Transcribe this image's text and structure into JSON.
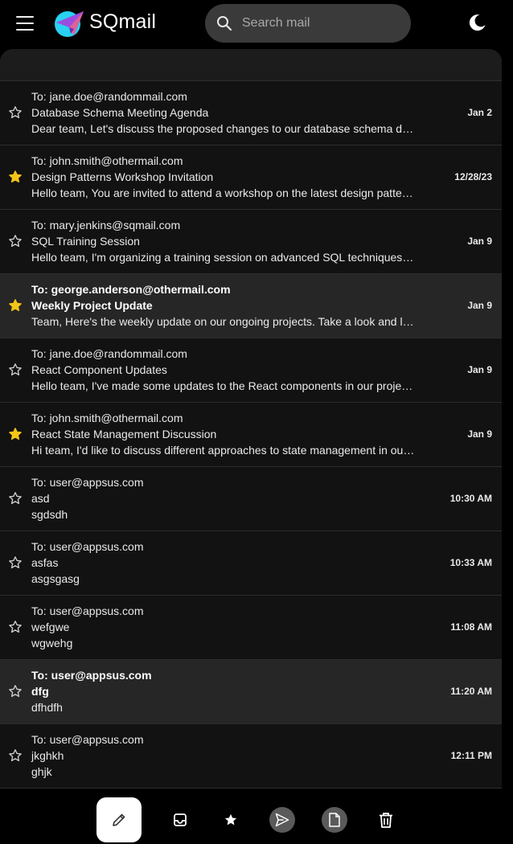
{
  "app": {
    "brand": "SQmail",
    "search_placeholder": "Search mail",
    "accent_star": "#f5c518",
    "logo_colors": [
      "#2ad1f0",
      "#9b4de0",
      "#e0609a"
    ]
  },
  "mails": [
    {
      "to": "To: jane.doe@randommail.com",
      "subject": "Database Schema Meeting Agenda",
      "preview": "Dear team, Let's discuss the proposed changes to our database schema during our next meeting.",
      "date": "Jan 2",
      "starred": false,
      "unread": false
    },
    {
      "to": "To: john.smith@othermail.com",
      "subject": "Design Patterns Workshop Invitation",
      "preview": "Hello team, You are invited to attend a workshop on the latest design patterns.",
      "date": "12/28/23",
      "starred": true,
      "unread": false
    },
    {
      "to": "To: mary.jenkins@sqmail.com",
      "subject": "SQL Training Session",
      "preview": "Hello team, I'm organizing a training session on advanced SQL techniques. Please join.",
      "date": "Jan 9",
      "starred": false,
      "unread": false
    },
    {
      "to": "To: george.anderson@othermail.com",
      "subject": "Weekly Project Update",
      "preview": "Team, Here's the weekly update on our ongoing projects. Take a look and let me know.",
      "date": "Jan 9",
      "starred": true,
      "unread": true
    },
    {
      "to": "To: jane.doe@randommail.com",
      "subject": "React Component Updates",
      "preview": "Hello team, I've made some updates to the React components in our project repository.",
      "date": "Jan 9",
      "starred": false,
      "unread": false
    },
    {
      "to": "To: john.smith@othermail.com",
      "subject": "React State Management Discussion",
      "preview": "Hi team, I'd like to discuss different approaches to state management in our app.",
      "date": "Jan 9",
      "starred": true,
      "unread": false
    },
    {
      "to": "To: user@appsus.com",
      "subject": "asd",
      "preview": "sgdsdh",
      "date": "10:30 AM",
      "starred": false,
      "unread": false
    },
    {
      "to": "To: user@appsus.com",
      "subject": "asfas",
      "preview": "asgsgasg",
      "date": "10:33 AM",
      "starred": false,
      "unread": false
    },
    {
      "to": "To: user@appsus.com",
      "subject": "wefgwe",
      "preview": "wgwehg",
      "date": "11:08 AM",
      "starred": false,
      "unread": false
    },
    {
      "to": "To: user@appsus.com",
      "subject": "dfg",
      "preview": "dfhdfh",
      "date": "11:20 AM",
      "starred": false,
      "unread": true
    },
    {
      "to": "To: user@appsus.com",
      "subject": "jkghkh",
      "preview": "ghjk",
      "date": "12:11 PM",
      "starred": false,
      "unread": false
    }
  ],
  "bottom_nav": {
    "items": [
      "compose-icon",
      "inbox-icon",
      "starred-icon",
      "sent-icon",
      "drafts-icon",
      "trash-icon"
    ],
    "active": "sent"
  }
}
